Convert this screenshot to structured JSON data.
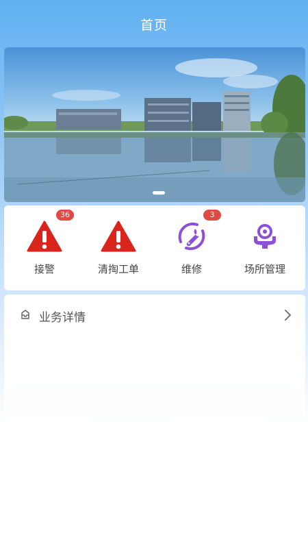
{
  "header": {
    "title": "首页"
  },
  "banner": {
    "pager_count": 1
  },
  "quick": {
    "items": [
      {
        "label": "接警",
        "badge": "36",
        "icon": "warning-triangle-icon"
      },
      {
        "label": "清掏工单",
        "badge": "",
        "icon": "warning-triangle-icon"
      },
      {
        "label": "维修",
        "badge": "3",
        "icon": "wrench-icon"
      },
      {
        "label": "场所管理",
        "badge": "",
        "icon": "location-hand-icon"
      }
    ]
  },
  "detail": {
    "title": "业务详情",
    "icon": "package-icon"
  },
  "colors": {
    "accent": "#5fb0f2",
    "alert": "#d9251c",
    "purple": "#8b4fd8",
    "badge": "#e04a45"
  }
}
